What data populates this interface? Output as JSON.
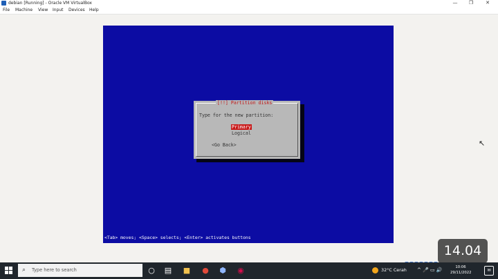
{
  "window": {
    "title": "debian [Running] - Oracle VM VirtualBox",
    "controls": {
      "minimize": "—",
      "restore": "❐",
      "close": "✕"
    }
  },
  "menu": [
    "File",
    "Machine",
    "View",
    "Input",
    "Devices",
    "Help"
  ],
  "installer": {
    "dialog_title": "[!!] Partition disks",
    "prompt": "Type for the new partition:",
    "options": [
      "Primary",
      "Logical"
    ],
    "selected_option": "Primary",
    "back_button": "<Go Back>",
    "help_line": "<Tab> moves; <Space> selects; <Enter> activates buttons",
    "colors": {
      "screen": "#0c0ca3",
      "dialog": "#b8b8b8",
      "highlight": "#c81818",
      "title": "#c01818"
    }
  },
  "overlay": {
    "timer": "14.04"
  },
  "taskbar": {
    "search_placeholder": "Type here to search",
    "weather_temp": "32°C",
    "weather_text": "Cerah",
    "tray_icons": "^ 🎤 ▭ 🔊",
    "time": "10:06",
    "date": "29/11/2022",
    "apps": [
      "task-view-icon",
      "file-explorer-icon",
      "chrome-icon",
      "virtualbox-icon",
      "debian-icon"
    ]
  }
}
